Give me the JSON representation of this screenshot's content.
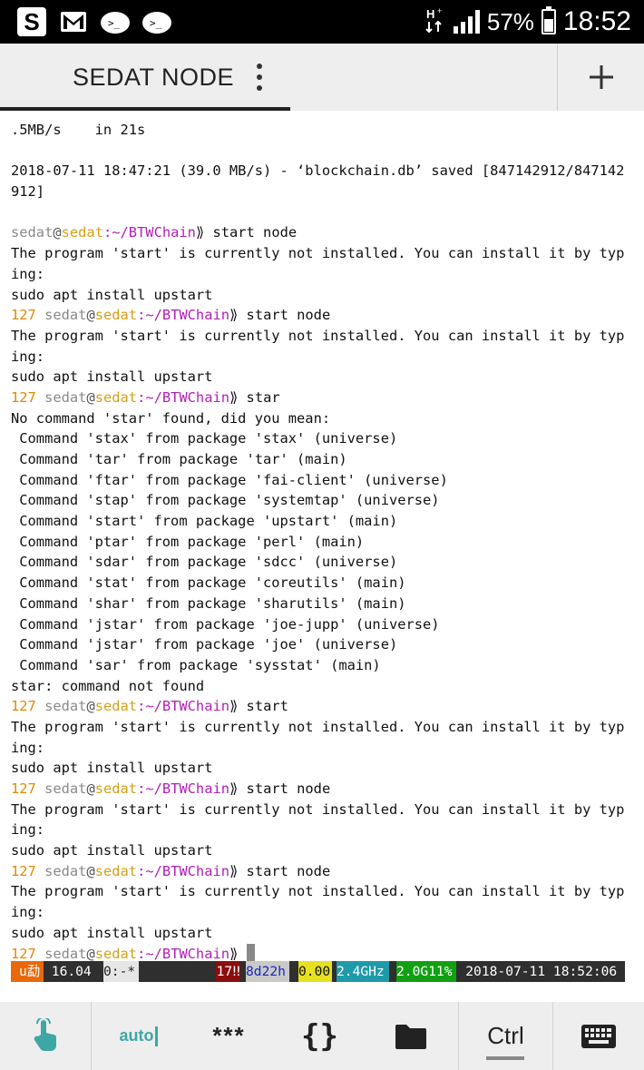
{
  "status_bar": {
    "battery_percent": "57%",
    "time": "18:52",
    "battery_level": 0.57,
    "icons": [
      "s-app-icon",
      "gmail-icon",
      "terminal-notification-icon",
      "terminal-notification-icon",
      "h-plus-data-icon",
      "signal-icon",
      "battery-icon"
    ]
  },
  "app_bar": {
    "tab_title": "SEDAT NODE",
    "menu_icon": "more-vert-icon",
    "add_icon": "plus-icon"
  },
  "prompt": {
    "user": "sedat",
    "at": "@",
    "host": "sedat",
    "path": ":~/BTWChain",
    "arrow": "⟫",
    "code": "127"
  },
  "terminal": {
    "line_0": ".5MB/s    in 21s",
    "line_1": "",
    "line_2": "2018-07-11 18:47:21 (39.0 MB/s) - ‘blockchain.db’ saved [847142912/847142",
    "line_3": "912]",
    "line_4": "",
    "line_5_cmd": " start node",
    "line_6": "The program 'start' is currently not installed. You can install it by typ",
    "line_7": "ing:",
    "line_8": "sudo apt install upstart",
    "line_9_cmd": " start node",
    "line_10": "The program 'start' is currently not installed. You can install it by typ",
    "line_11": "ing:",
    "line_12": "sudo apt install upstart",
    "line_13_cmd": " star",
    "line_14": "No command 'star' found, did you mean:",
    "line_15": " Command 'stax' from package 'stax' (universe)",
    "line_16": " Command 'tar' from package 'tar' (main)",
    "line_17": " Command 'ftar' from package 'fai-client' (universe)",
    "line_18": " Command 'stap' from package 'systemtap' (universe)",
    "line_19": " Command 'start' from package 'upstart' (main)",
    "line_20": " Command 'ptar' from package 'perl' (main)",
    "line_21": " Command 'sdar' from package 'sdcc' (universe)",
    "line_22": " Command 'stat' from package 'coreutils' (main)",
    "line_23": " Command 'shar' from package 'sharutils' (main)",
    "line_24": " Command 'jstar' from package 'joe-jupp' (universe)",
    "line_25": " Command 'jstar' from package 'joe' (universe)",
    "line_26": " Command 'sar' from package 'sysstat' (main)",
    "line_27": "star: command not found",
    "line_28_cmd": " start",
    "line_29": "The program 'start' is currently not installed. You can install it by typ",
    "line_30": "ing:",
    "line_31": "sudo apt install upstart",
    "line_32_cmd": " start node",
    "line_33": "The program 'start' is currently not installed. You can install it by typ",
    "line_34": "ing:",
    "line_35": "sudo apt install upstart",
    "line_36_cmd": " start node",
    "line_37": "The program 'start' is currently not installed. You can install it by typ",
    "line_38": "ing:",
    "line_39": "sudo apt install upstart"
  },
  "tmux_bar": {
    "seg_1": "u勐",
    "seg_2": " 16.04 ",
    "seg_3": "0:-*",
    "seg_4": "17‼",
    "seg_5": "8d22h",
    "seg_6": "0.00",
    "seg_7": "2.4GHz",
    "seg_8": "2.0G11%",
    "seg_9": " 2018-07-11 18:52:06 ",
    "colors": {
      "seg_1_bg": "#e8690b",
      "seg_2_bg": "#2f2f2f",
      "seg_3_bg": "#e6e6e6",
      "seg_fill_bg": "#2f2f2f",
      "seg_4_bg": "#8b0d0d",
      "seg_5_bg": "#c9c9c9",
      "seg_5_fg": "#1a2ab8",
      "seg_6_bg": "#e6e021",
      "seg_7_bg": "#1f9aa8",
      "seg_8_bg": "#12a012",
      "seg_9_bg": "#2f2f2f"
    }
  },
  "toolbar": {
    "touch_icon": "touch-gesture-icon",
    "auto_label": "auto",
    "stars_label": "***",
    "braces_label": "{}",
    "folder_icon": "folder-icon",
    "ctrl_label": "Ctrl",
    "keyboard_icon": "keyboard-icon"
  }
}
